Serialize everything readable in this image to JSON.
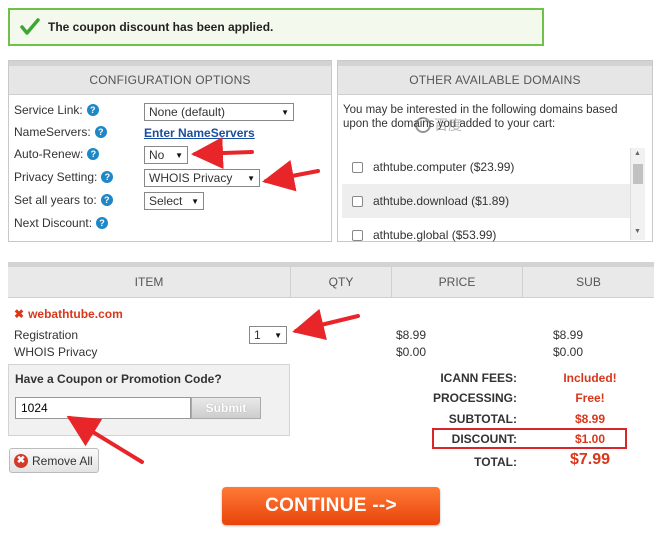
{
  "banner": {
    "message": "The coupon discount has been applied."
  },
  "config": {
    "title": "CONFIGURATION OPTIONS",
    "service_link": {
      "label": "Service Link:",
      "value": "None (default)"
    },
    "nameservers": {
      "label": "NameServers:",
      "link": "Enter NameServers"
    },
    "auto_renew": {
      "label": "Auto-Renew:",
      "value": "No"
    },
    "privacy": {
      "label": "Privacy Setting:",
      "value": "WHOIS Privacy"
    },
    "all_years": {
      "label": "Set all years to:",
      "value": "Select"
    },
    "next_discount": {
      "label": "Next Discount:"
    },
    "help_glyph": "?"
  },
  "domains": {
    "title": "OTHER AVAILABLE DOMAINS",
    "intro": "You may be interested in the following domains based upon the domains you added to your cart:",
    "items": [
      {
        "label": "athtube.computer ($23.99)"
      },
      {
        "label": "athtube.download ($1.89)"
      },
      {
        "label": "athtube.global ($53.99)"
      }
    ]
  },
  "cart": {
    "headers": {
      "item": "ITEM",
      "qty": "QTY",
      "price": "PRICE",
      "sub": "SUB"
    },
    "domain": "webathtube.com",
    "remove_glyph": "✖",
    "rows": [
      {
        "label": "Registration",
        "qty": "1",
        "price": "$8.99",
        "sub": "$8.99"
      },
      {
        "label": "WHOIS Privacy",
        "price": "$0.00",
        "sub": "$0.00"
      }
    ]
  },
  "coupon": {
    "title": "Have a Coupon or Promotion Code?",
    "value": "1024",
    "submit": "Submit"
  },
  "remove_all": {
    "label": "Remove All"
  },
  "totals": {
    "icann": {
      "label": "ICANN FEES:",
      "value": "Included!"
    },
    "processing": {
      "label": "PROCESSING:",
      "value": "Free!"
    },
    "subtotal": {
      "label": "SUBTOTAL:",
      "value": "$8.99"
    },
    "discount": {
      "label": "DISCOUNT:",
      "value": "$1.00"
    },
    "total": {
      "label": "TOTAL:",
      "value": "$7.99"
    }
  },
  "continue": {
    "label": "CONTINUE -->"
  },
  "watermark": {
    "text": "百度"
  },
  "colors": {
    "accent_orange": "#ef5a17",
    "price_red": "#d9371a",
    "annotation_red": "#e8262a",
    "success_green": "#6ec24a"
  }
}
